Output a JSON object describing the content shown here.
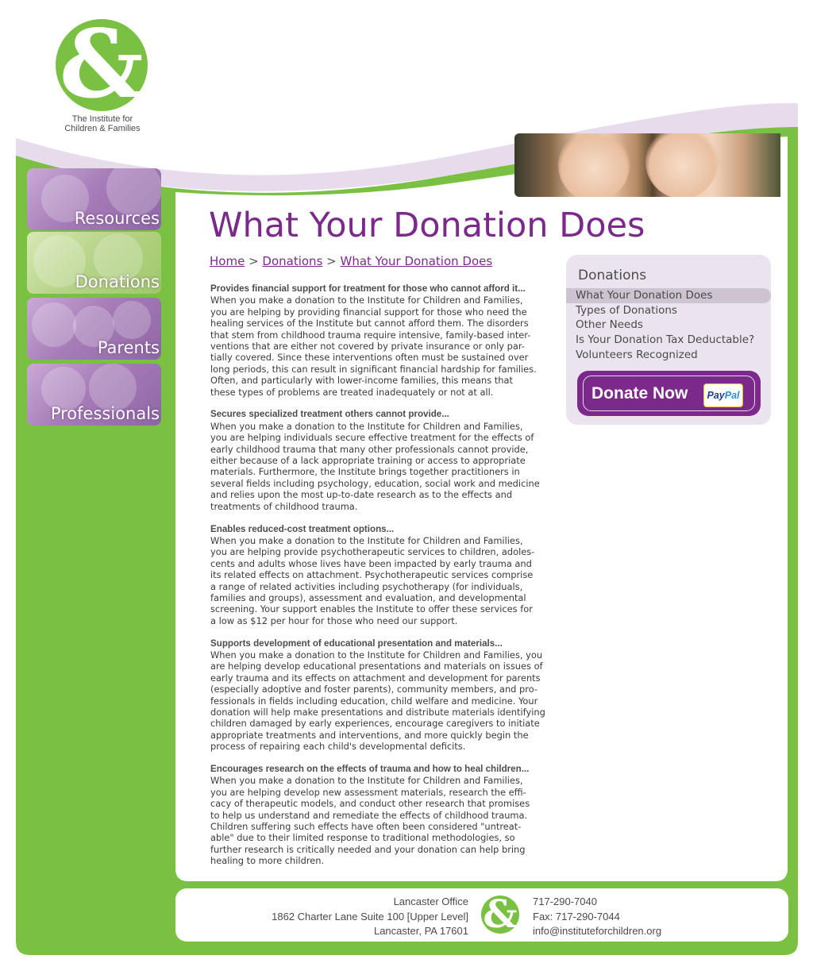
{
  "colors": {
    "green": "#7ac143",
    "purple": "#7b2a8b",
    "lavender": "#ebe4ee",
    "text": "#3a3a3a"
  },
  "logo": {
    "icon": "ampersand-logo",
    "line1": "The Institute for",
    "line2": "Children & Families"
  },
  "nav": [
    {
      "label": "Resources",
      "icon": "resources-photo"
    },
    {
      "label": "Donations",
      "icon": "donations-photo"
    },
    {
      "label": "Parents",
      "icon": "parents-photo"
    },
    {
      "label": "Professionals",
      "icon": "professionals-photo"
    }
  ],
  "page": {
    "title": "What Your Donation Does"
  },
  "breadcrumb": {
    "home": "Home",
    "sep1": " > ",
    "donations": "Donations",
    "sep2": " > ",
    "current": "What Your Donation Does"
  },
  "article": [
    {
      "heading": "Provides financial support for treatment for those who cannot afford it...",
      "body": "When you make a donation to the Institute for Children and Families,\nyou are helping by providing financial support for those who need the\nhealing services of the Institute but cannot afford them. The disorders\nthat stem from childhood trauma require intensive, family-based inter-\nventions that are either not covered by private insurance or only par-\ntially covered. Since these interventions often must be sustained over\nlong periods, this can result in significant financial hardship for families.\nOften, and particularly with lower-income families, this means that\nthese types of problems are treated inadequately or not at all."
    },
    {
      "heading": "Secures specialized treatment others cannot provide...",
      "body": "When you make a donation to the Institute for Children and Families,\nyou are helping individuals secure effective treatment for the effects of\nearly childhood trauma that many other professionals cannot provide,\neither because of a lack appropriate training or access to appropriate\nmaterials. Furthermore, the Institute brings together practitioners in\nseveral fields including psychology, education, social work and medicine\nand relies upon the most up-to-date research as to the effects and\ntreatments of childhood trauma."
    },
    {
      "heading": "Enables reduced-cost treatment options...",
      "body": "When you make a donation to the Institute for Children and Families,\nyou are helping provide psychotherapeutic services to children, adoles-\ncents and adults whose lives have been impacted by early trauma and\nits related effects on attachment. Psychotherapeutic services comprise\na range of related activities including psychotherapy (for individuals,\nfamilies and groups), assessment and evaluation, and developmental\nscreening. Your support enables the Institute to offer these services for\na low as $12 per hour for those who need our support."
    },
    {
      "heading": "Supports development of educational presentation and materials...",
      "body": "When you make a donation to the Institute for Children and Families, you\nare helping develop educational presentations and materials on issues of\nearly trauma and its effects on attachment and development for parents\n(especially adoptive and foster parents), community members, and pro-\nfessionals in fields including education, child welfare and medicine. Your\ndonation will help make presentations and distribute materials identifying\nchildren damaged by early experiences, encourage caregivers to initiate\nappropriate treatments and interventions, and more quickly begin the\nprocess of repairing each child's developmental deficits."
    },
    {
      "heading": "Encourages research on the effects of trauma and how to heal children...",
      "body": "When you make a donation to the Institute for Children and Families,\nyou are helping develop new assessment materials, research the effi-\ncacy of therapeutic models, and conduct other research that promises\nto help us understand and remediate the effects of childhood trauma.\nChildren suffering such effects have often been considered \"untreat-\nable\" due to their limited response to traditional methodologies, so\nfurther research is critically needed and your donation can help bring\nhealing to more children."
    }
  ],
  "sidebar": {
    "title": "Donations",
    "items": [
      {
        "label": "What Your Donation Does",
        "active": true
      },
      {
        "label": "Types of Donations",
        "active": false
      },
      {
        "label": "Other Needs",
        "active": false
      },
      {
        "label": "Is Your Donation Tax Deductable?",
        "active": false
      },
      {
        "label": "Volunteers Recognized",
        "active": false
      }
    ],
    "donate": {
      "label": "Donate Now",
      "paypal_pay": "Pay",
      "paypal_pal": "Pal"
    }
  },
  "footer": {
    "office": "Lancaster Office",
    "address1": "1862 Charter Lane Suite 100 [Upper Level]",
    "address2": "Lancaster, PA 17601",
    "phone": "717-290-7040",
    "fax": "Fax: 717-290-7044",
    "email": "info@instituteforchildren.org"
  }
}
